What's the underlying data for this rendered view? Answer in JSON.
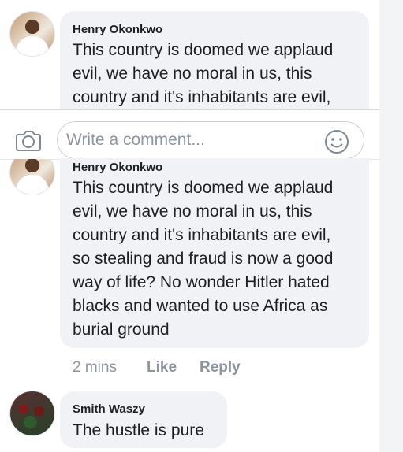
{
  "comments": [
    {
      "author": "Henry Okonkwo",
      "text": "This country is doomed we applaud\nevil, we have no moral in us, this\ncountry and it's inhabitants are evil,"
    },
    {
      "author": "Henry Okonkwo",
      "text": "This country is doomed we applaud\nevil, we have no moral in us, this\ncountry and it's inhabitants are evil,\nso stealing and fraud is now a good\nway of life?  No wonder Hitler hated\nblacks and wanted to use Africa as\nburial ground",
      "time": "2 mins",
      "like_label": "Like",
      "reply_label": "Reply"
    },
    {
      "author": "Smith Waszy",
      "text": "The hustle is pure"
    }
  ],
  "composer": {
    "placeholder": "Write a comment...",
    "camera_icon": "camera-icon",
    "emoji_icon": "smiley-icon"
  }
}
